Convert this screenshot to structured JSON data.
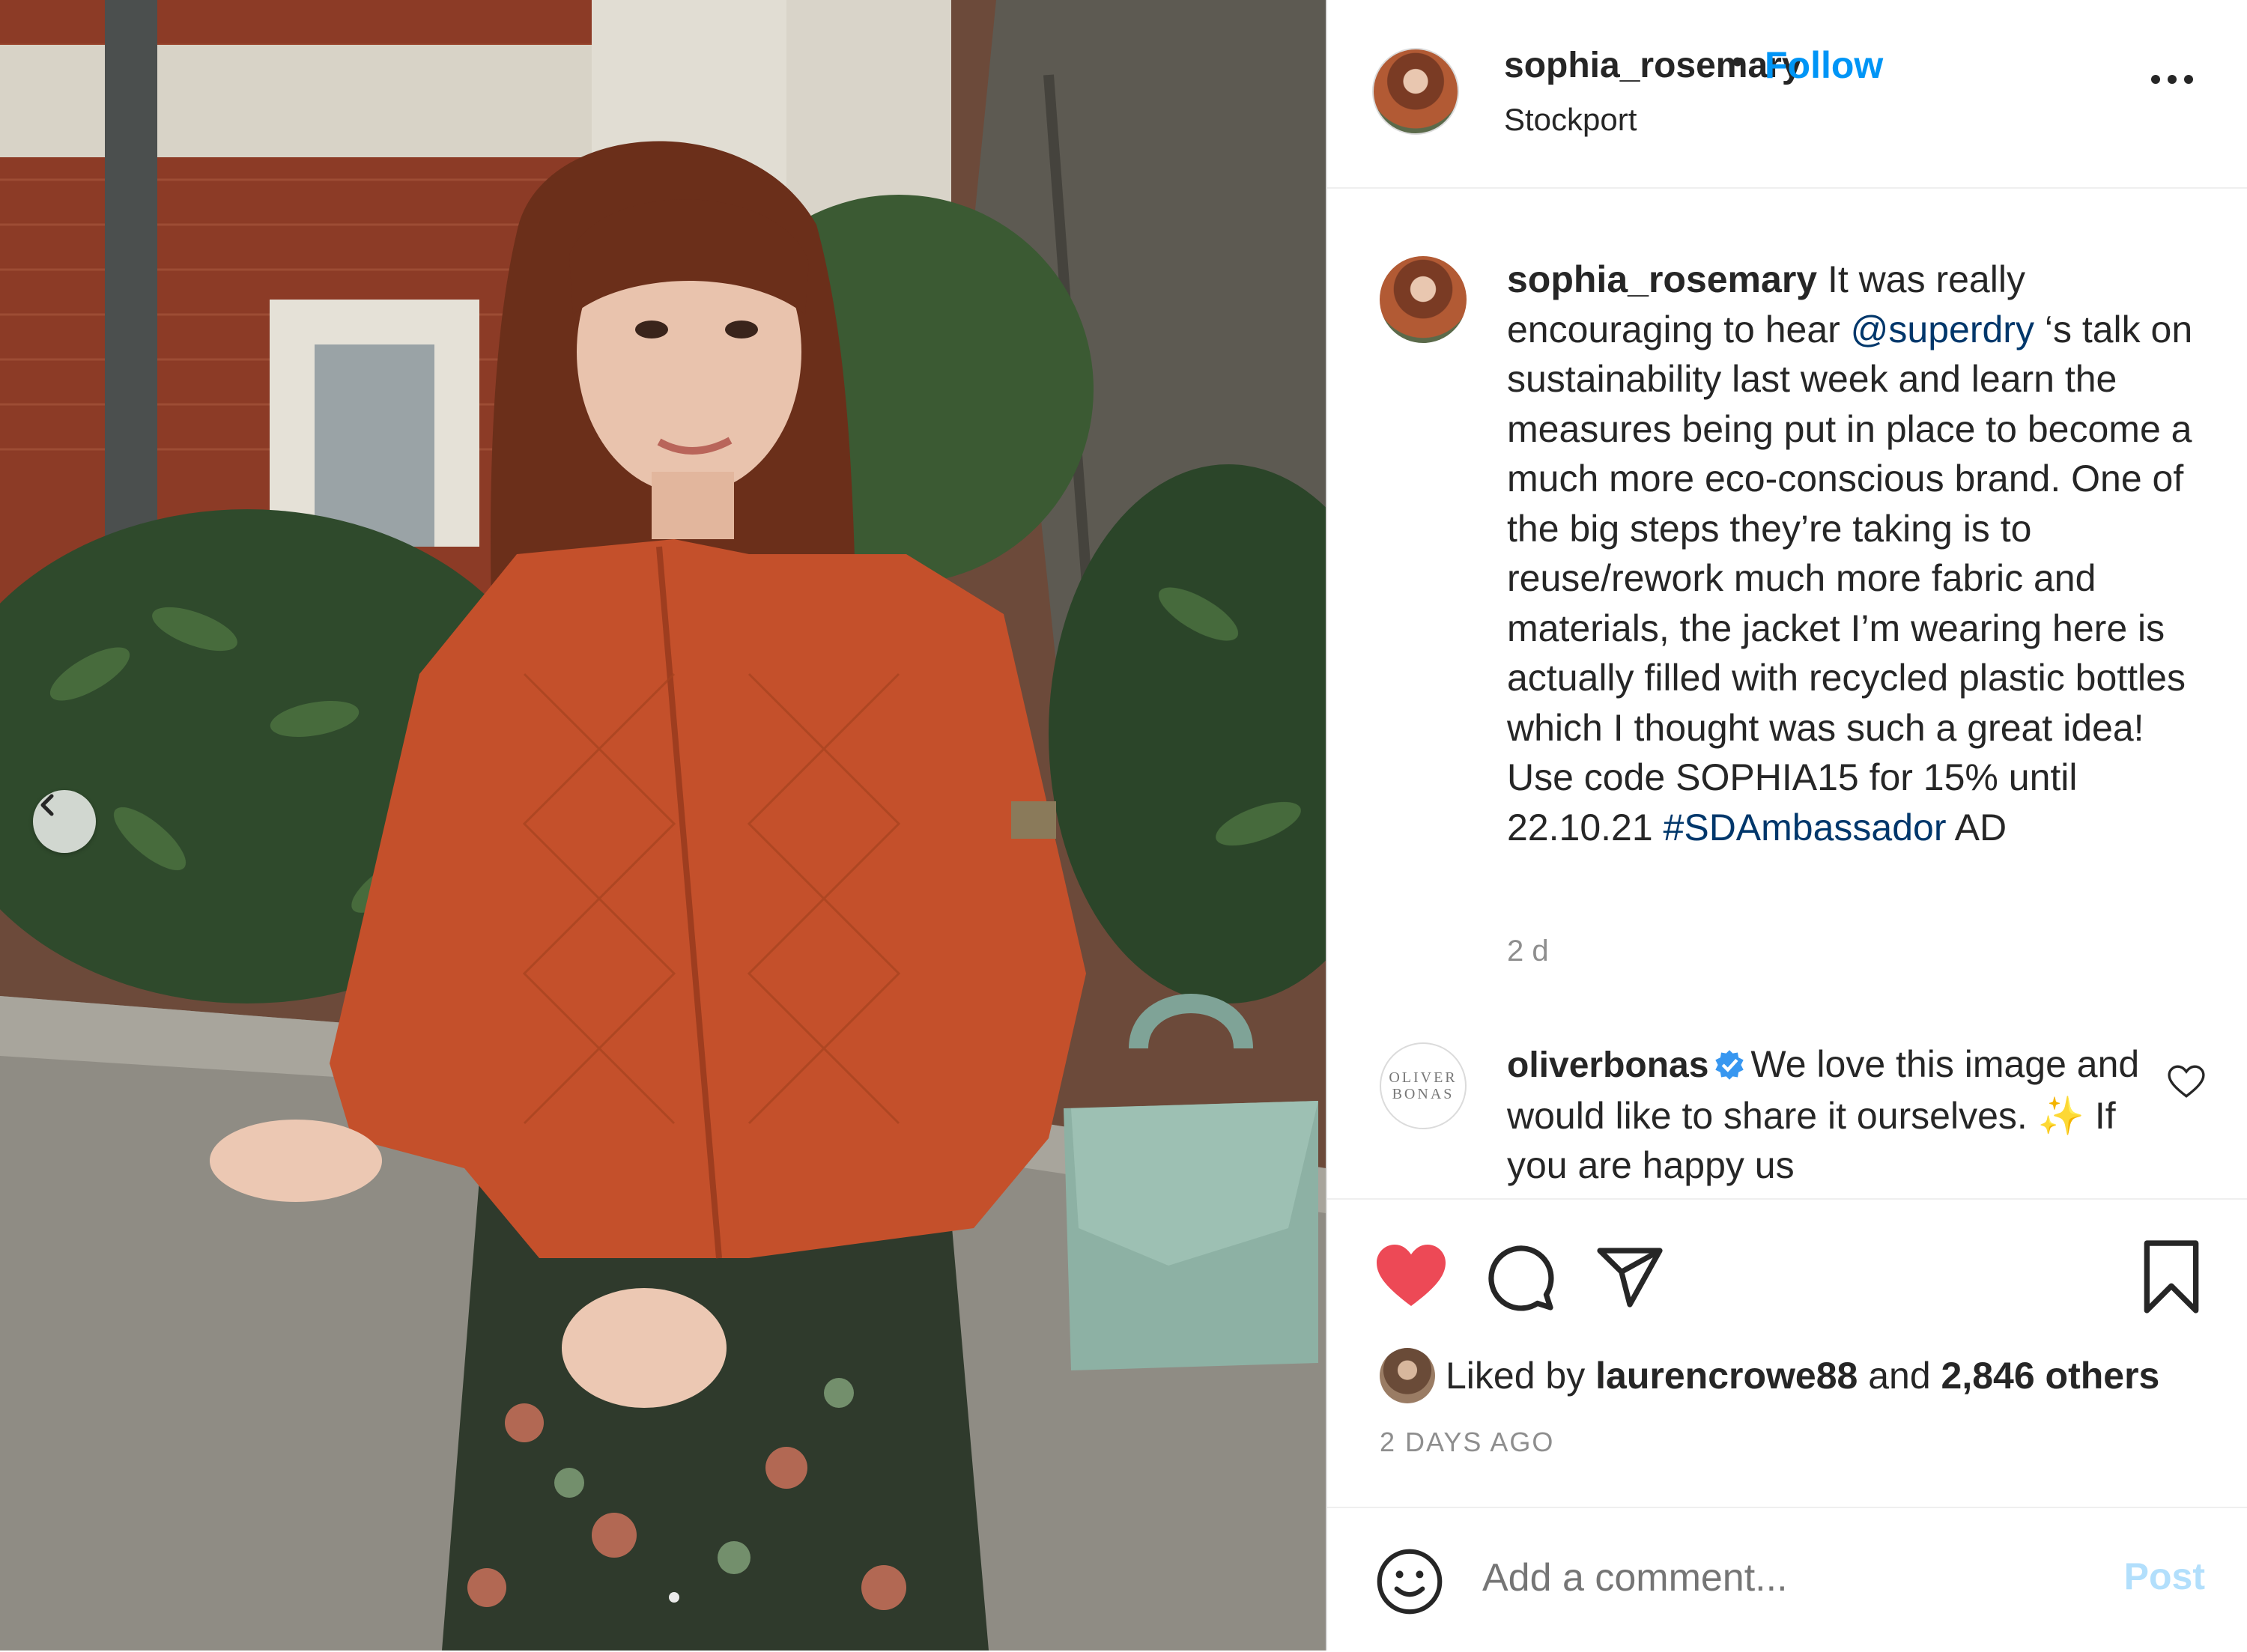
{
  "header": {
    "username": "sophia_rosemary",
    "separator": "•",
    "follow_label": "Follow",
    "location": "Stockport"
  },
  "caption": {
    "username": "sophia_rosemary",
    "text_1": " It was really encouraging to hear ",
    "mention": "@superdry",
    "text_2": " ‘s talk on sustainability last week and learn the measures being put in place to become a much more eco-conscious brand. One of the big steps they’re taking is to reuse/rework much more fabric and materials, the jacket I’m wearing here is actually filled with recycled plastic bottles which I thought was such a great idea! Use code SOPHIA15 for 15% until 22.10.21 ",
    "hashtag": "#SDAmbassador",
    "text_3": " AD",
    "age": "2 d"
  },
  "comment": {
    "avatar_line1": "OLIVER",
    "avatar_line2": "BONAS",
    "username": "oliverbonas",
    "text_1": "We love this image and would like to share it ourselves. ",
    "sparkle": "✨",
    "text_2": " If you are happy us"
  },
  "likes": {
    "prefix": "Liked by ",
    "user": "laurencrowe88",
    "middle": " and ",
    "others": "2,846 others"
  },
  "date": "2 DAYS AGO",
  "comment_box": {
    "placeholder": "Add a comment...",
    "post_label": "Post"
  },
  "icons": {
    "like": "heart-filled-icon",
    "comment": "comment-bubble-icon",
    "share": "paper-plane-icon",
    "save": "bookmark-icon",
    "emoji": "smiley-icon",
    "prev": "chevron-left-icon"
  },
  "colors": {
    "accent": "#0095f6",
    "link": "#00376b",
    "like_red": "#ed4956",
    "muted": "#8e8e8e",
    "post_disabled": "#b2dffc"
  }
}
